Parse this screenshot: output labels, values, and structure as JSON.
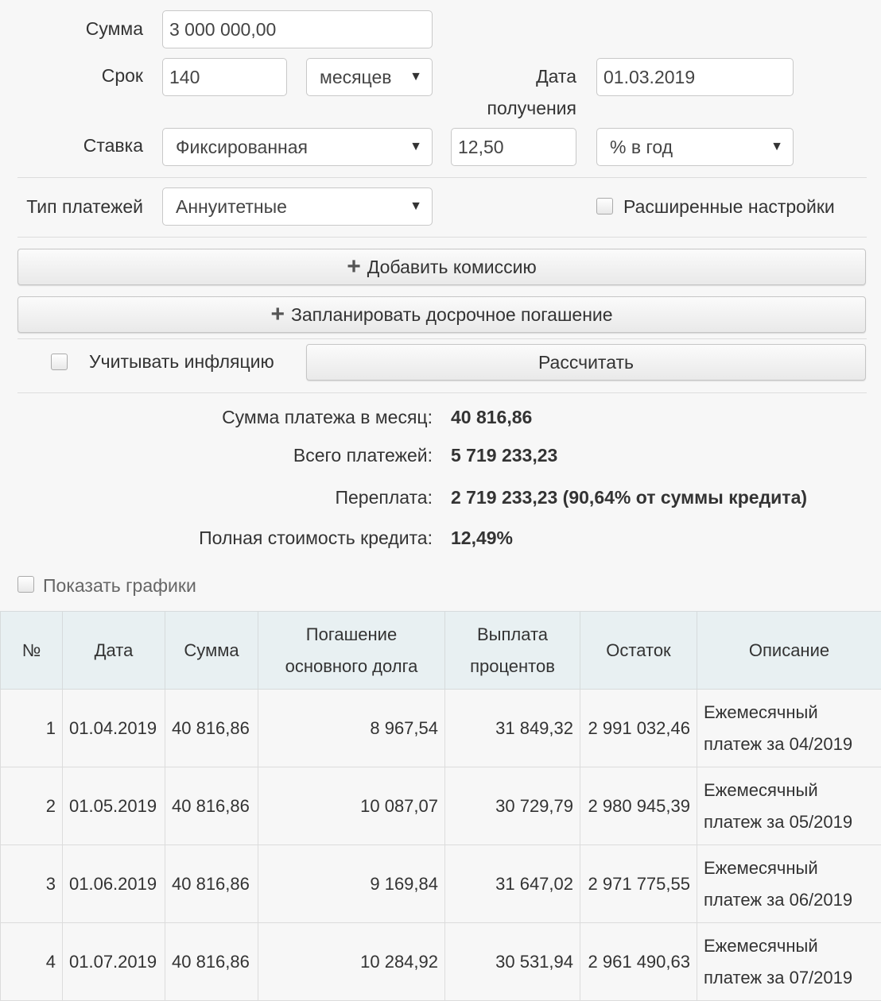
{
  "form": {
    "amount_label": "Сумма",
    "amount_value": "3 000 000,00",
    "term_label": "Срок",
    "term_value": "140",
    "term_unit": "месяцев",
    "date_label_1": "Дата",
    "date_label_2": "получения",
    "date_value": "01.03.2019",
    "rate_label": "Ставка",
    "rate_type": "Фиксированная",
    "rate_value": "12,50",
    "rate_unit": "% в год",
    "payment_type_label": "Тип платежей",
    "payment_type": "Аннуитетные",
    "advanced_label": "Расширенные настройки",
    "add_commission": "Добавить комиссию",
    "plan_prepayment": "Запланировать досрочное погашение",
    "inflation_label": "Учитывать инфляцию",
    "calculate": "Рассчитать"
  },
  "results": {
    "monthly_label": "Сумма платежа в месяц:",
    "monthly_value": "40 816,86",
    "total_label": "Всего платежей:",
    "total_value": "5 719 233,23",
    "overpay_label": "Переплата:",
    "overpay_value": "2 719 233,23 (90,64% от суммы кредита)",
    "full_cost_label": "Полная стоимость кредита:",
    "full_cost_value": "12,49%"
  },
  "show_charts_label": "Показать графики",
  "schedule": {
    "headers": {
      "num": "№",
      "date": "Дата",
      "sum": "Сумма",
      "principal_1": "Погашение",
      "principal_2": "основного долга",
      "interest_1": "Выплата",
      "interest_2": "процентов",
      "balance": "Остаток",
      "desc": "Описание"
    },
    "rows": [
      {
        "num": "1",
        "date": "01.04.2019",
        "sum": "40 816,86",
        "principal": "8 967,54",
        "interest": "31 849,32",
        "balance": "2 991 032,46",
        "desc_1": "Ежемесячный",
        "desc_2": "платеж за 04/2019"
      },
      {
        "num": "2",
        "date": "01.05.2019",
        "sum": "40 816,86",
        "principal": "10 087,07",
        "interest": "30 729,79",
        "balance": "2 980 945,39",
        "desc_1": "Ежемесячный",
        "desc_2": "платеж за 05/2019"
      },
      {
        "num": "3",
        "date": "01.06.2019",
        "sum": "40 816,86",
        "principal": "9 169,84",
        "interest": "31 647,02",
        "balance": "2 971 775,55",
        "desc_1": "Ежемесячный",
        "desc_2": "платеж за 06/2019"
      },
      {
        "num": "4",
        "date": "01.07.2019",
        "sum": "40 816,86",
        "principal": "10 284,92",
        "interest": "30 531,94",
        "balance": "2 961 490,63",
        "desc_1": "Ежемесячный",
        "desc_2": "платеж за 07/2019"
      }
    ]
  }
}
